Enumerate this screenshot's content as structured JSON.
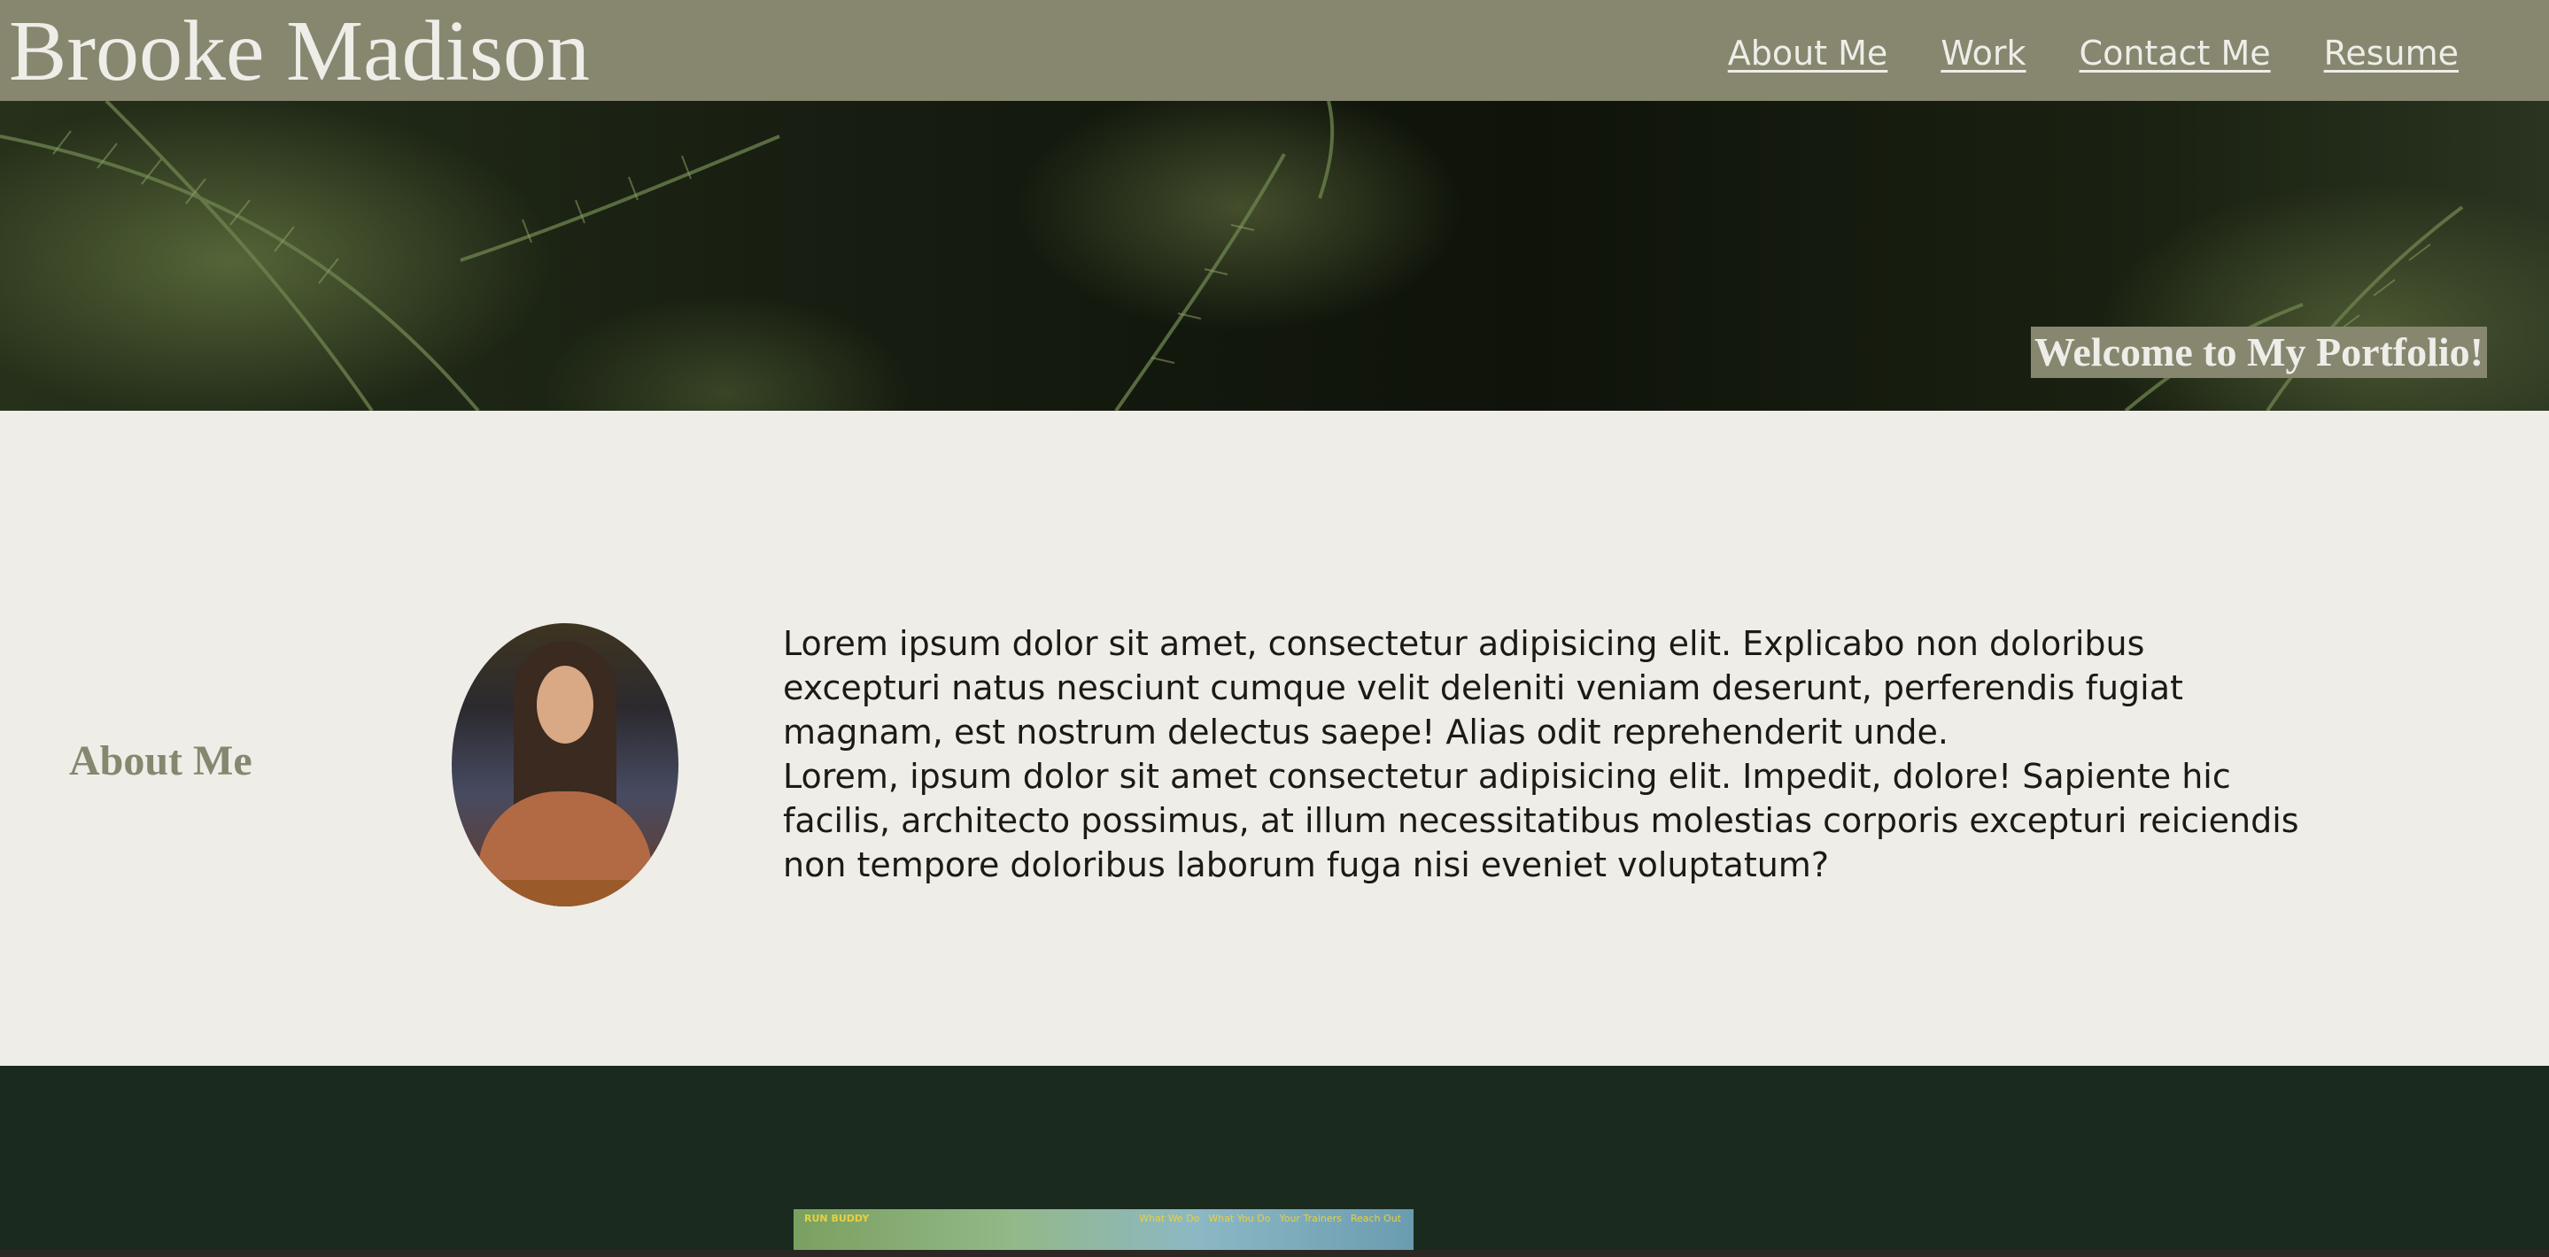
{
  "header": {
    "site_title": "Brooke Madison",
    "nav": [
      "About Me",
      "Work",
      "Contact Me",
      "Resume"
    ]
  },
  "hero": {
    "welcome": "Welcome to My Portfolio!"
  },
  "about": {
    "heading": "About Me",
    "paragraphs": [
      "Lorem ipsum dolor sit amet, consectetur adipisicing elit. Explicabo non doloribus excepturi natus nesciunt cumque velit deleniti veniam deserunt, perferendis fugiat magnam, est nostrum delectus saepe! Alias odit reprehenderit unde.",
      "Lorem, ipsum dolor sit amet consectetur adipisicing elit. Impedit, dolore! Sapiente hic facilis, architecto possimus, at illum necessitatibus molestias corporis excepturi reiciendis non tempore doloribus laborum fuga nisi eveniet voluptatum?"
    ]
  },
  "work": {
    "thumbnail": {
      "brand": "RUN BUDDY",
      "nav": [
        "What We Do",
        "What You Do",
        "Your Trainers",
        "Reach Out"
      ]
    }
  },
  "colors": {
    "header_bg": "#878770",
    "page_bg": "#eeede8",
    "accent_text": "#878770",
    "work_bg": "#1a2a1e"
  }
}
